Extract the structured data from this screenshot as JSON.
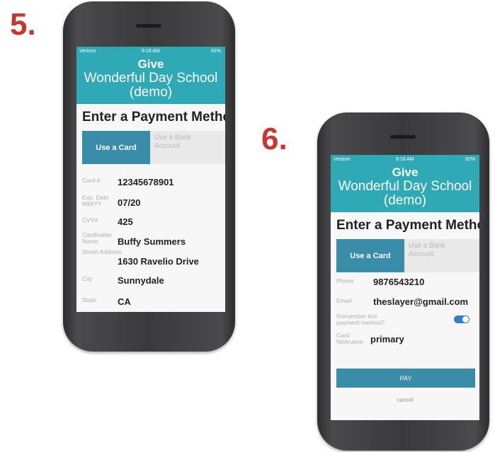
{
  "steps": {
    "left": "5.",
    "right": "6."
  },
  "status_bar": {
    "carrier": "Verizon",
    "time": "9:16 AM",
    "battery": "92%"
  },
  "header": {
    "give": "Give",
    "org_line1": "Wonderful Day School",
    "org_line2": "(demo)"
  },
  "page_title": "Enter a Payment Method",
  "tabs": {
    "card": "Use a Card",
    "bank_line1": "Use a Bank",
    "bank_line2": "Account"
  },
  "phone1": {
    "fields": [
      {
        "label": "Card #",
        "value": "12345678901"
      },
      {
        "label": "Exp. Date MM/YY",
        "value": "07/20"
      },
      {
        "label": "CVV#",
        "value": "425"
      },
      {
        "label": "Cardholder Name",
        "value": "Buffy Summers"
      },
      {
        "label": "Street Address",
        "value": "1630 Ravelio Drive"
      },
      {
        "label": "City",
        "value": "Sunnydale"
      },
      {
        "label": "State",
        "value": "CA"
      }
    ]
  },
  "phone2": {
    "fields": [
      {
        "label": "Phone",
        "value": "9876543210"
      },
      {
        "label": "Email",
        "value": "theslayer@gmail.com"
      }
    ],
    "remember_label": "Remember this payment method?",
    "remember_on": true,
    "nickname_label": "Card Nickname",
    "nickname_value": "primary",
    "pay_label": "PAY",
    "cancel_label": "cancel"
  }
}
